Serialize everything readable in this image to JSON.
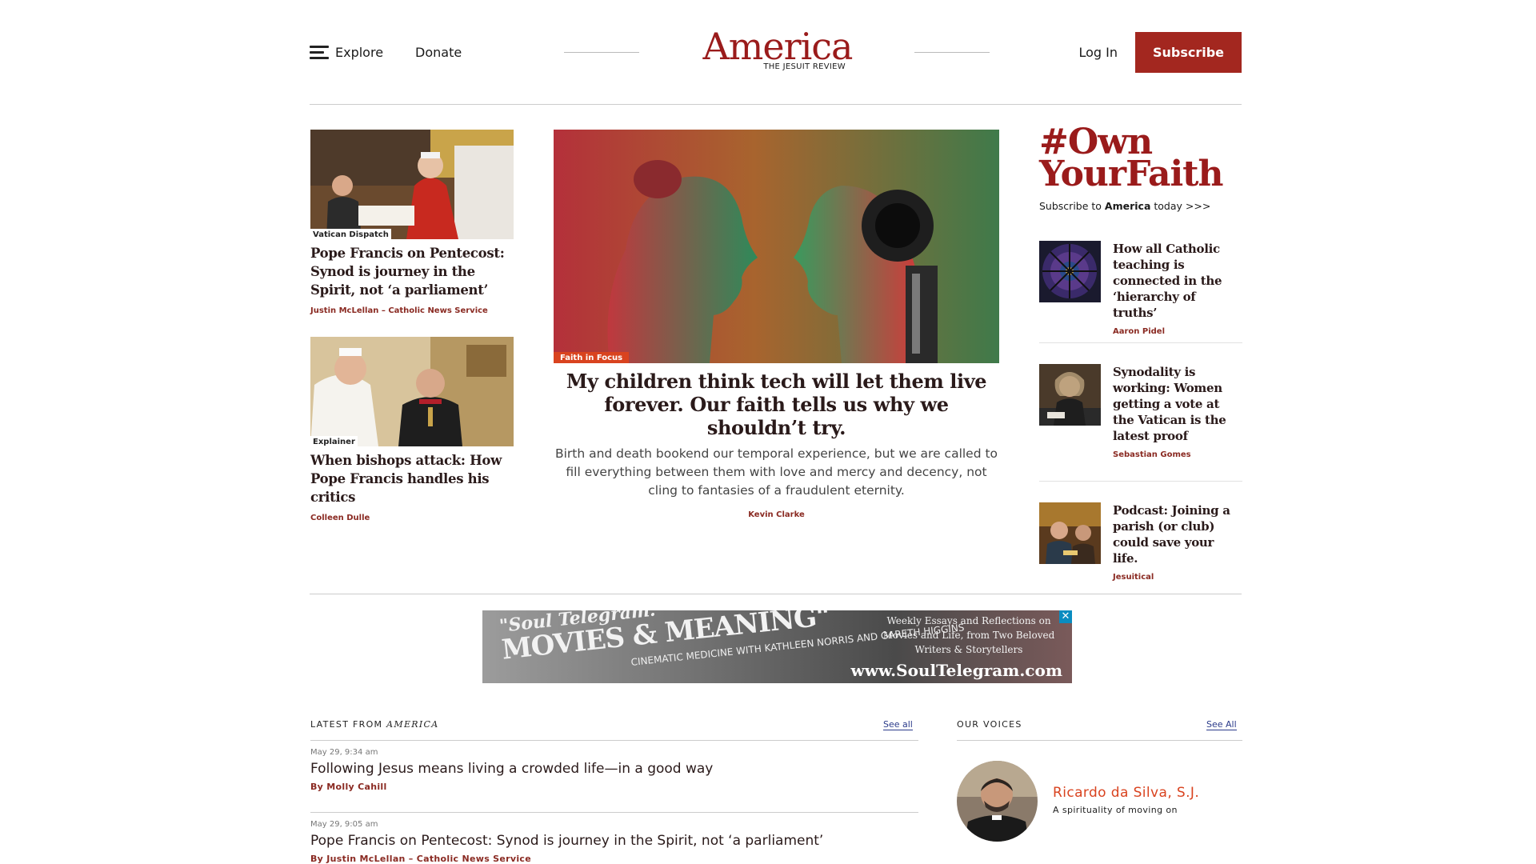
{
  "header": {
    "explore_label": "Explore",
    "donate_label": "Donate",
    "logo_word": "America",
    "logo_sub": "THE JESUIT REVIEW",
    "login_label": "Log In",
    "subscribe_label": "Subscribe",
    "brand_color": "#9a1b1b",
    "subscribe_color": "#a3271f"
  },
  "left_cards": [
    {
      "tag": "Vatican Dispatch",
      "title": "Pope Francis on Pentecost: Synod is journey in the Spirit, not ‘a parliament’",
      "byline": "Justin McLellan – Catholic News Service"
    },
    {
      "tag": "Explainer",
      "title": "When bishops attack: How Pope Francis handles his critics",
      "byline": "Colleen Dulle"
    }
  ],
  "feature": {
    "tag": "Faith in Focus",
    "title": "My children think tech will let them live forever. Our faith tells us why we shouldn’t try.",
    "dek": "Birth and death bookend our temporal experience, but we are called to fill everything between them with love and mercy and decency, not cling to fantasies of a fraudulent eternity.",
    "byline": "Kevin Clarke",
    "tag_color": "#d9431f"
  },
  "own_faith": {
    "title_line1": "#Own",
    "title_line2": "YourFaith",
    "sub_prefix": "Subscribe to ",
    "sub_brand": "America",
    "sub_suffix": " today >>>"
  },
  "side_items": [
    {
      "title": "How all Catholic teaching is connected in the ‘hierarchy of truths’",
      "byline": "Aaron Pidel"
    },
    {
      "title": "Synodality is working: Women getting a vote at the Vatican is the latest proof",
      "byline": "Sebastian Gomes"
    },
    {
      "title": "Podcast: Joining a parish (or club) could save your life.",
      "byline": "Jesuitical"
    }
  ],
  "ad": {
    "line1": "\"Soul Telegram:",
    "line2": "MOVIES & MEANING\"",
    "mid": "CINEMATIC MEDICINE WITH KATHLEEN NORRIS AND GARETH HIGGINS",
    "right": "Weekly Essays and Reflections on Movies and Life, from Two Beloved Writers & Storytellers",
    "url": "www.SoulTelegram.com",
    "close": "✕"
  },
  "latest": {
    "label_prefix": "LATEST FROM ",
    "label_brand": "AMERICA",
    "see_all": "See all",
    "items": [
      {
        "time": "May 29, 9:34 am",
        "title": "Following Jesus means living a crowded life—in a good way",
        "byline": "By Molly Cahill"
      },
      {
        "time": "May 29, 9:05 am",
        "title": "Pope Francis on Pentecost: Synod is journey in the Spirit, not ‘a parliament’",
        "byline": "By Justin McLellan – Catholic News Service"
      }
    ]
  },
  "voices": {
    "label": "OUR VOICES",
    "see_all": "See All",
    "name": "Ricardo da Silva, S.J.",
    "sub": "A spirituality of moving on",
    "name_color": "#d9431f"
  }
}
